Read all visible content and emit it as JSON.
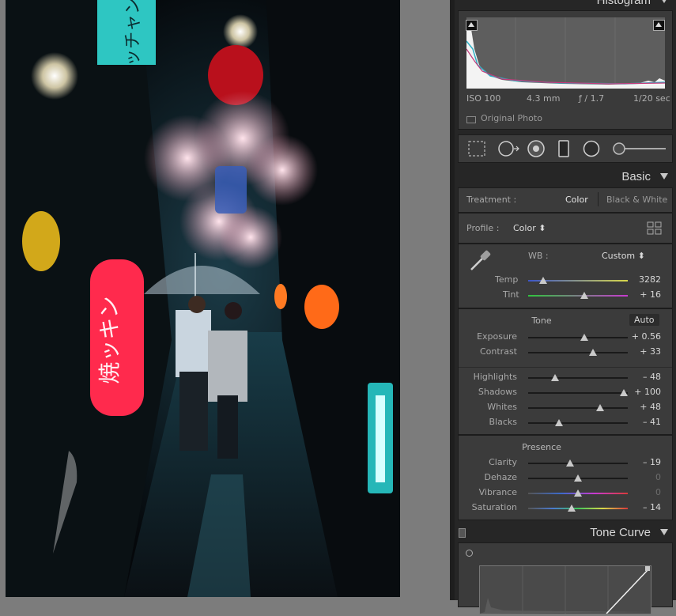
{
  "histogram": {
    "title": "Histogram",
    "iso": "ISO 100",
    "focal_length": "4.3 mm",
    "aperture": "ƒ / 1.7",
    "shutter": "1/20 sec",
    "original_photo_label": "Original Photo"
  },
  "tools": [
    "crop-overlay-tool",
    "spot-removal-tool",
    "red-eye-tool",
    "graduated-filter-tool",
    "radial-filter-tool",
    "adjustment-brush-slider"
  ],
  "basic": {
    "title": "Basic",
    "treatment_label": "Treatment :",
    "treatment_color": "Color",
    "treatment_bw": "Black & White",
    "profile_label": "Profile :",
    "profile_value": "Color ⬍",
    "wb_label": "WB :",
    "wb_value": "Custom ⬍",
    "tone_label": "Tone",
    "auto_label": "Auto",
    "presence_label": "Presence",
    "sliders": {
      "temp": {
        "label": "Temp",
        "value": "3282",
        "fraction": 0.15
      },
      "tint": {
        "label": "Tint",
        "value": "+ 16",
        "fraction": 0.56
      },
      "exposure": {
        "label": "Exposure",
        "value": "+ 0.56",
        "fraction": 0.56
      },
      "contrast": {
        "label": "Contrast",
        "value": "+ 33",
        "fraction": 0.65
      },
      "highlights": {
        "label": "Highlights",
        "value": "– 48",
        "fraction": 0.27
      },
      "shadows": {
        "label": "Shadows",
        "value": "+ 100",
        "fraction": 0.96
      },
      "whites": {
        "label": "Whites",
        "value": "+ 48",
        "fraction": 0.72
      },
      "blacks": {
        "label": "Blacks",
        "value": "– 41",
        "fraction": 0.31
      },
      "clarity": {
        "label": "Clarity",
        "value": "– 19",
        "fraction": 0.42
      },
      "dehaze": {
        "label": "Dehaze",
        "value": "0",
        "fraction": 0.5
      },
      "vibrance": {
        "label": "Vibrance",
        "value": "0",
        "fraction": 0.5
      },
      "saturation": {
        "label": "Saturation",
        "value": "– 14",
        "fraction": 0.44
      }
    }
  },
  "tone_curve": {
    "title": "Tone Curve"
  },
  "colors": {
    "panel_bg": "#262626",
    "box_bg": "#3b3b3b",
    "photo_bg": "#05080b",
    "neon_cyan": "#2fd3d6",
    "lantern_red": "#ff2a4d"
  }
}
